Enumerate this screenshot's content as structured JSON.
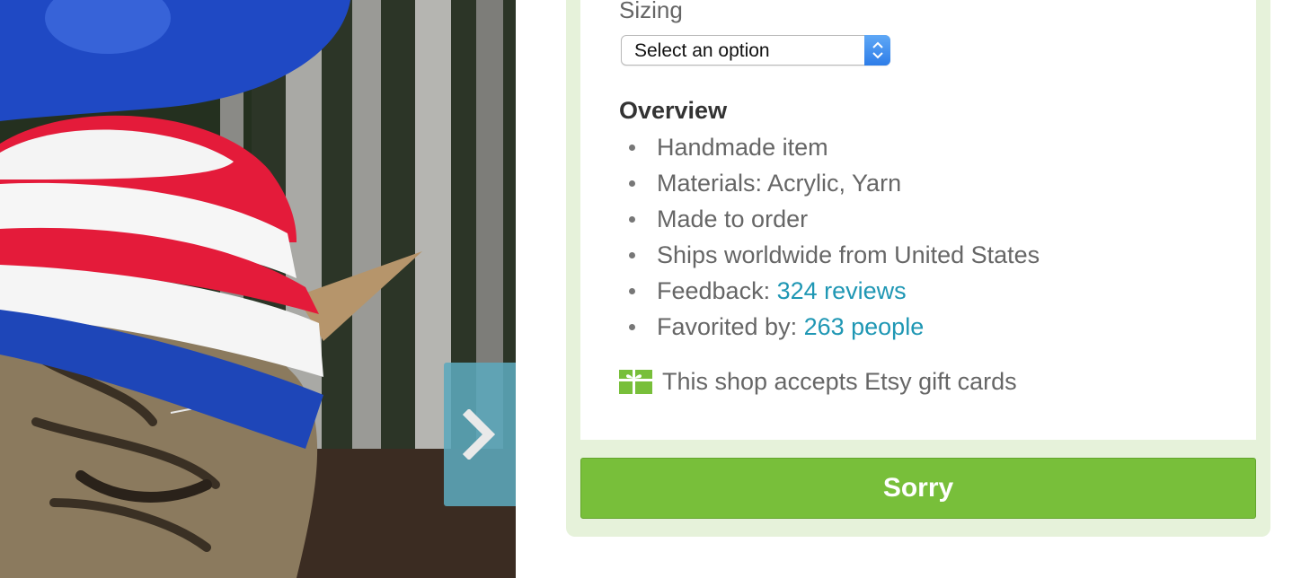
{
  "photo": {
    "alt_subject": "cat-in-crochet-hat-photo"
  },
  "navigation": {
    "next_icon": "chevron-right-icon"
  },
  "product": {
    "sizing_label": "Sizing",
    "select": {
      "value": "Select an option"
    },
    "overview": {
      "title": "Overview",
      "items": [
        {
          "text": "Handmade item"
        },
        {
          "text": "Materials: Acrylic, Yarn"
        },
        {
          "text": "Made to order"
        },
        {
          "text": "Ships worldwide from United States"
        },
        {
          "text": "Feedback: ",
          "link": "324 reviews"
        },
        {
          "text": "Favorited by: ",
          "link": "263 people"
        }
      ]
    },
    "gift_card": {
      "icon": "gift-card-icon",
      "text": "This shop accepts Etsy gift cards"
    },
    "action_button": {
      "label": "Sorry"
    }
  },
  "colors": {
    "panel_bg": "#e6f2da",
    "button_green": "#78bf3a",
    "link_blue": "#1f97b4",
    "arrow_overlay": "#5ca8bc"
  }
}
